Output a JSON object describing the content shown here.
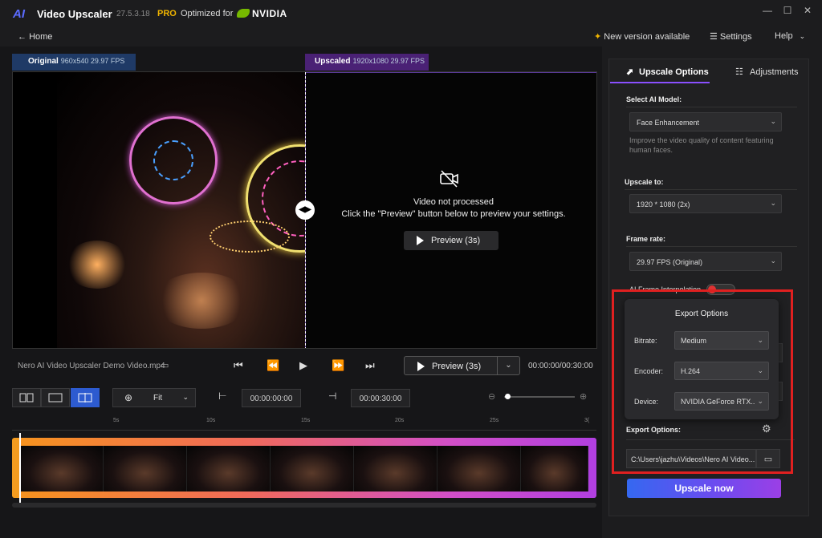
{
  "app": {
    "logo_text": "AI",
    "title": "Video Upscaler",
    "version": "27.5.3.18",
    "pro": "PRO",
    "optimized": "Optimized for",
    "nvidia": "NVIDIA"
  },
  "window": {
    "minimize": "—",
    "maximize": "☐",
    "close": "✕"
  },
  "nav": {
    "home": "Home",
    "new_version": "New version available",
    "settings": "Settings",
    "help": "Help"
  },
  "video": {
    "original_label": "Original",
    "original_meta": "960x540 29.97 FPS",
    "upscaled_label": "Upscaled",
    "upscaled_meta": "1920x1080 29.97 FPS",
    "not_processed": "Video not processed",
    "instruction": "Click the \"Preview\" button below to preview your settings.",
    "preview_center": "Preview (3s)"
  },
  "controls": {
    "filename": "Nero AI Video Upscaler Demo Video.mp4",
    "preview": "Preview (3s)",
    "timecode": "00:00:00/00:30:00"
  },
  "toolbar": {
    "fit": "Fit",
    "start_time": "00:00:00:00",
    "end_time": "00:00:30:00"
  },
  "ruler": {
    "labels": [
      "5s",
      "10s",
      "15s",
      "20s",
      "25s",
      "3("
    ]
  },
  "panel": {
    "tab_upscale": "Upscale Options",
    "tab_adjust": "Adjustments",
    "model_label": "Select AI Model:",
    "model_value": "Face Enhancement",
    "model_help": "Improve the video quality of content featuring human faces.",
    "upscale_label": "Upscale to:",
    "upscale_value": "1920 * 1080 (2x)",
    "framerate_label": "Frame rate:",
    "framerate_value": "29.97 FPS (Original)",
    "interp_label": "AI Frame Interpolation",
    "export_label": "Export Options:",
    "export_path": "C:\\Users\\jazhu\\Videos\\Nero AI Video...",
    "upscale_now": "Upscale now"
  },
  "popup": {
    "title": "Export Options",
    "bitrate_label": "Bitrate:",
    "bitrate_value": "Medium",
    "encoder_label": "Encoder:",
    "encoder_value": "H.264",
    "device_label": "Device:",
    "device_value": "NVIDIA GeForce RTX..."
  },
  "colors": {
    "accent": "#8a4fff",
    "highlight": "#e02020",
    "pro": "#f0b400",
    "nvidia": "#76b900"
  }
}
